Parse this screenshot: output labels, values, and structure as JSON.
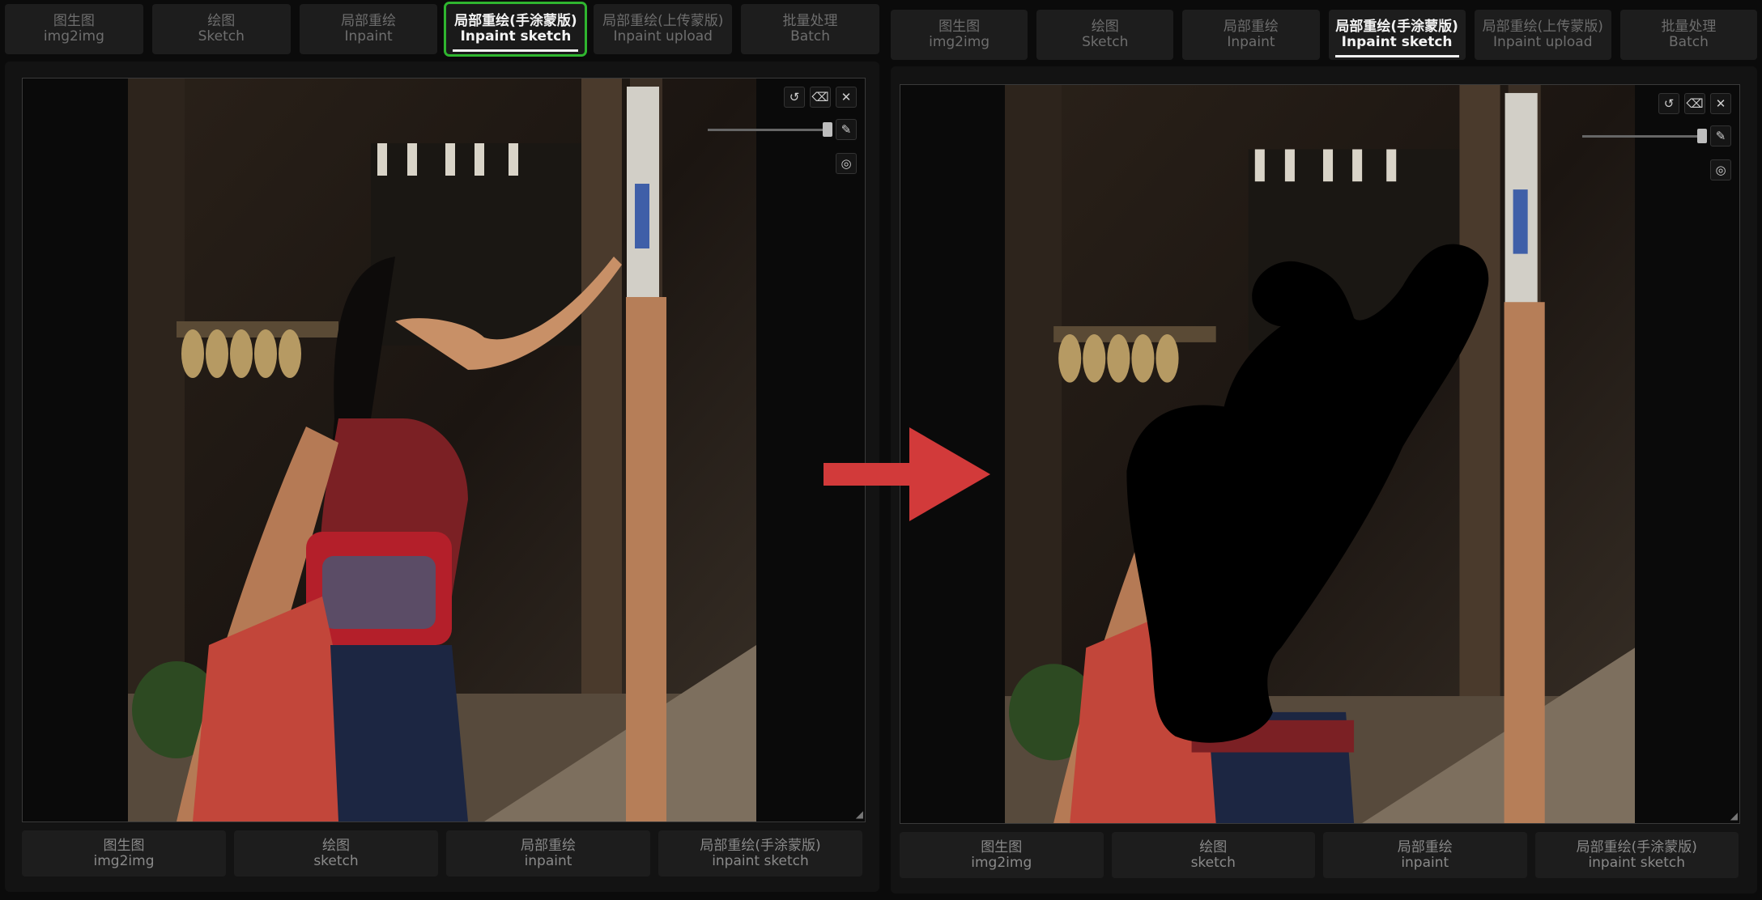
{
  "tabs": [
    {
      "cn": "图生图",
      "en": "img2img"
    },
    {
      "cn": "绘图",
      "en": "Sketch"
    },
    {
      "cn": "局部重绘",
      "en": "Inpaint"
    },
    {
      "cn": "局部重绘(手涂蒙版)",
      "en": "Inpaint sketch"
    },
    {
      "cn": "局部重绘(上传蒙版)",
      "en": "Inpaint upload"
    },
    {
      "cn": "批量处理",
      "en": "Batch"
    }
  ],
  "active_tab": "Inpaint sketch",
  "bottom_buttons": [
    {
      "cn": "图生图",
      "en": "img2img"
    },
    {
      "cn": "绘图",
      "en": "sketch"
    },
    {
      "cn": "局部重绘",
      "en": "inpaint"
    },
    {
      "cn": "局部重绘(手涂蒙版)",
      "en": "inpaint sketch"
    }
  ],
  "toolbar_icons": [
    "undo-icon",
    "eraser-icon",
    "close-icon"
  ],
  "side_tool_icons": [
    "brush-icon",
    "palette-icon"
  ],
  "brush_size_level": 0.85,
  "colors": {
    "highlight": "#2fb52f",
    "arrow": "#d23a3a",
    "mask": "#000000"
  },
  "photo_description_icon": "street-scene-image"
}
